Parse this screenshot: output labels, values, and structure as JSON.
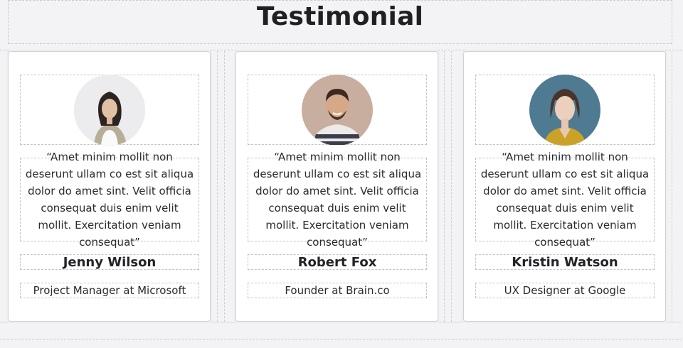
{
  "header": {
    "title": "Testimonial"
  },
  "testimonials": [
    {
      "quote": "“Amet minim mollit non deserunt ullam co est sit aliqua dolor do amet sint. Velit officia consequat duis enim velit mollit. Exercitation veniam consequat”",
      "name": "Jenny Wilson",
      "role": "Project Manager at Microsoft",
      "avatar_bg": "#e3e3e5"
    },
    {
      "quote": "“Amet minim mollit non deserunt ullam co est sit aliqua dolor do amet sint. Velit officia consequat duis enim velit mollit. Exercitation veniam consequat”",
      "name": "Robert Fox",
      "role": "Founder at Brain.co",
      "avatar_bg": "#c6ada0"
    },
    {
      "quote": "“Amet minim mollit non deserunt ullam co est sit aliqua dolor do amet sint. Velit officia consequat duis enim velit mollit. Exercitation veniam consequat”",
      "name": "Kristin Watson",
      "role": "UX Designer at Google",
      "avatar_bg": "#4d7890"
    }
  ]
}
